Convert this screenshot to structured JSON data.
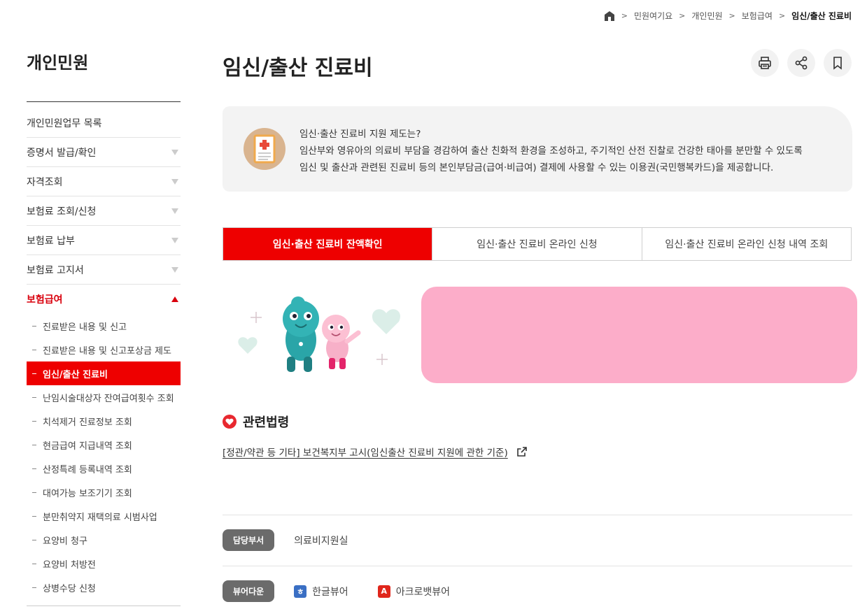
{
  "breadcrumb": {
    "items": [
      "민원여기요",
      "개인민원",
      "보험급여"
    ],
    "current": "임신/출산 진료비"
  },
  "sidebar": {
    "title": "개인민원",
    "items": [
      {
        "label": "개인민원업무 목록",
        "has_arrow": false
      },
      {
        "label": "증명서 발급/확인",
        "has_arrow": true
      },
      {
        "label": "자격조회",
        "has_arrow": true
      },
      {
        "label": "보험료 조회/신청",
        "has_arrow": true
      },
      {
        "label": "보험료 납부",
        "has_arrow": true
      },
      {
        "label": "보험료 고지서",
        "has_arrow": true
      }
    ],
    "open_item": "보험급여",
    "sub_items": [
      "진료받은 내용 및 신고",
      "진료받은 내용 및 신고포상금 제도",
      "임신/출산 진료비",
      "난임시술대상자 잔여급여횟수 조회",
      "치석제거 진료정보 조회",
      "현금급여 지급내역 조회",
      "산정특례 등록내역 조회",
      "대여가능 보조기기 조회",
      "분만취약지 재택의료 시범사업",
      "요양비 청구",
      "요양비 처방전",
      "상병수당 신청"
    ],
    "active_sub_index": 2
  },
  "page": {
    "title": "임신/출산 진료비"
  },
  "intro": {
    "line1": "임신·출산 진료비 지원 제도는?",
    "line2": "임산부와 영유아의 의료비 부담을 경감하여 출산 친화적 환경을 조성하고, 주기적인 산전 진찰로 건강한 태아를 분만할 수 있도록",
    "line3": "임신 및 출산과 관련된 진료비 등의 본인부담금(급여·비급여) 결제에 사용할 수 있는 이용권(국민행복카드)을 제공합니다."
  },
  "tabs": [
    {
      "label": "임신·출산 진료비 잔액확인",
      "active": true
    },
    {
      "label": "임신·출산 진료비 온라인 신청",
      "active": false
    },
    {
      "label": "임신·출산 진료비 온라인 신청 내역 조회",
      "active": false
    }
  ],
  "laws": {
    "title": "관련법령",
    "link": "[정관/약관 등 기타] 보건복지부 고시(임신출산 진료비 지원에 관한 기준)"
  },
  "department": {
    "label": "담당부서",
    "value": "의료비지원실"
  },
  "viewers": {
    "label": "뷰어다운",
    "hwp": "한글뷰어",
    "acrobat": "아크로뱃뷰어"
  },
  "colors": {
    "accent": "#ee0000",
    "pink_banner": "#fcadc9",
    "intro_bg": "#f3f3f3",
    "pill_bg": "#6b6b6b"
  },
  "icons": {
    "breadcrumb_home": "home-icon",
    "tools": [
      "print-icon",
      "share-icon",
      "bookmark-icon"
    ],
    "laws": "heart-icon",
    "link_external": "external-link-icon"
  }
}
